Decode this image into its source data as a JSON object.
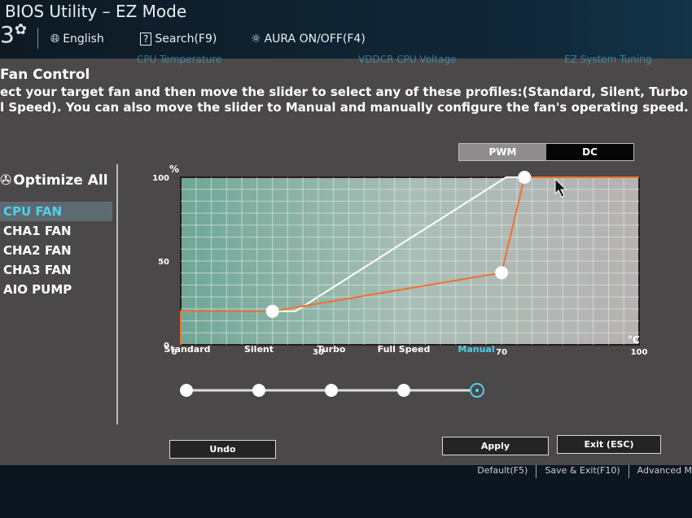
{
  "header": {
    "title": "BIOS Utility – EZ Mode",
    "logo": "3",
    "settings_icon": "gear-icon",
    "toolbar": [
      {
        "icon": "globe-icon",
        "label": "English"
      },
      {
        "icon": "question-icon",
        "label": "Search(F9)"
      },
      {
        "icon": "aura-icon",
        "label": "AURA ON/OFF(F4)"
      }
    ],
    "hidden_tabs": [
      "CPU Temperature",
      "VDDCR CPU Voltage",
      "EZ System Tuning"
    ]
  },
  "fan_control": {
    "title": "Fan Control",
    "description_line1": "ect your target fan and then move the slider to select any of these profiles:(Standard, Silent, Turbo and",
    "description_line2": "l Speed). You can also move the slider to Manual and manually configure the fan's operating speed.",
    "optimize_all": "Optimize All",
    "fans": [
      "CPU FAN",
      "CHA1 FAN",
      "CHA2 FAN",
      "CHA3 FAN",
      "AIO PUMP"
    ],
    "selected_fan": "CPU FAN",
    "mode_toggle": {
      "options": [
        "PWM",
        "DC"
      ],
      "selected": "PWM"
    },
    "profiles": [
      "Standard",
      "Silent",
      "Turbo",
      "Full Speed",
      "Manual"
    ],
    "selected_profile": "Manual",
    "buttons": {
      "undo": "Undo",
      "apply": "Apply",
      "exit": "Exit (ESC)"
    }
  },
  "footer": [
    "Default(F5)",
    "Save & Exit(F10)",
    "Advanced M"
  ],
  "colors": {
    "accent": "#4fd0ee",
    "curve": "#f07030",
    "reference": "#ffffff"
  },
  "chart_data": {
    "type": "line",
    "ylabel": "%",
    "xlabel": "°C",
    "xlim": [
      0,
      100
    ],
    "ylim": [
      0,
      100
    ],
    "xticks": [
      0,
      30,
      70,
      100
    ],
    "yticks": [
      0,
      50,
      100
    ],
    "grid": true,
    "series": [
      {
        "points": [
          [
            0,
            0
          ],
          [
            0,
            20
          ],
          [
            20,
            20
          ],
          [
            70,
            43
          ],
          [
            75,
            100
          ],
          [
            100,
            100
          ]
        ],
        "handles": [
          [
            20,
            20
          ],
          [
            70,
            43
          ],
          [
            75,
            100
          ]
        ],
        "color": "#f07030"
      },
      {
        "points": [
          [
            20,
            20
          ],
          [
            25,
            20
          ],
          [
            71,
            100
          ],
          [
            75,
            100
          ]
        ],
        "color": "#ffffff"
      }
    ]
  }
}
